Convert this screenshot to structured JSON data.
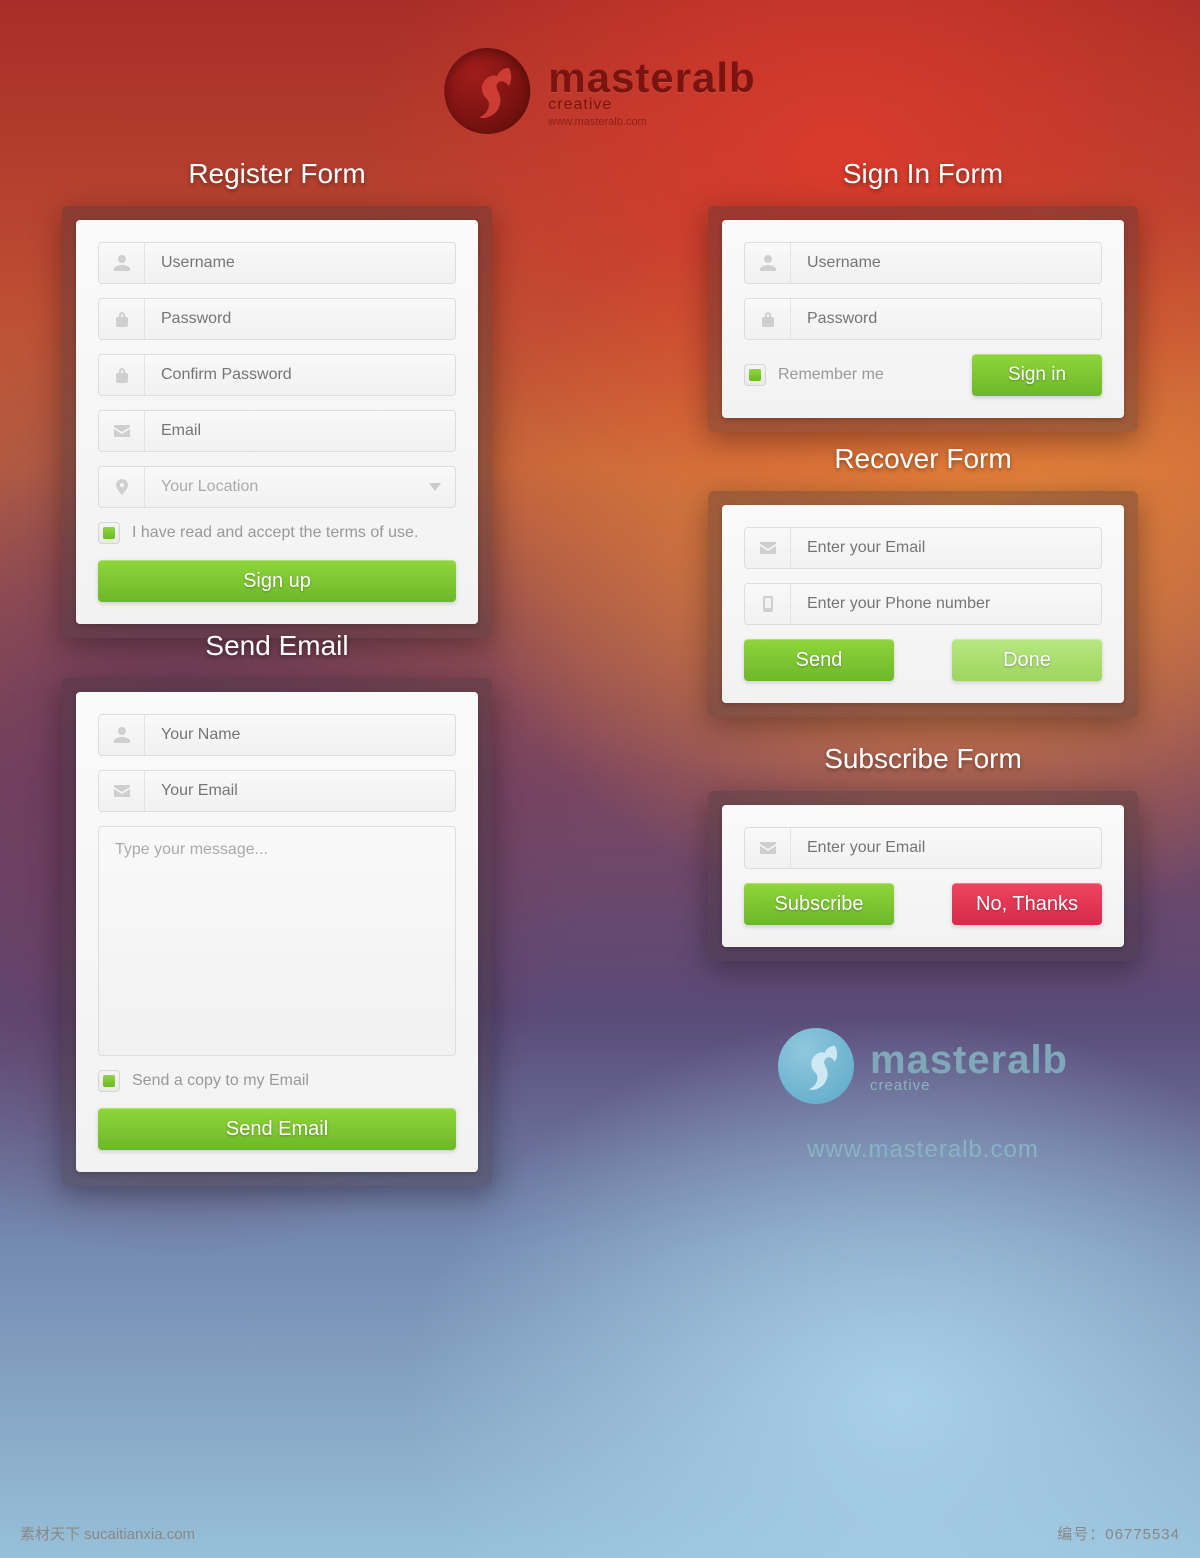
{
  "brand": {
    "name": "masteralb",
    "sub": "creative",
    "url_small": "www.masteralb.com",
    "url": "www.masteralb.com"
  },
  "register": {
    "title": "Register Form",
    "username": "Username",
    "password": "Password",
    "confirm": "Confirm Password",
    "email": "Email",
    "location": "Your Location",
    "terms": "I have read and accept the terms of use.",
    "button": "Sign up"
  },
  "signin": {
    "title": "Sign In Form",
    "username": "Username",
    "password": "Password",
    "remember": "Remember me",
    "button": "Sign in"
  },
  "recover": {
    "title": "Recover Form",
    "email": "Enter your Email",
    "phone": "Enter your Phone number",
    "send": "Send",
    "done": "Done"
  },
  "subscribe": {
    "title": "Subscribe Form",
    "email": "Enter your Email",
    "yes": "Subscribe",
    "no": "No, Thanks"
  },
  "send": {
    "title": "Send Email",
    "name": "Your Name",
    "email": "Your Email",
    "message": "Type your message...",
    "copy": "Send a copy to my Email",
    "button": "Send Email"
  },
  "footer": {
    "left": "素材天下 sucaitianxia.com",
    "right": "编号：06775534"
  }
}
